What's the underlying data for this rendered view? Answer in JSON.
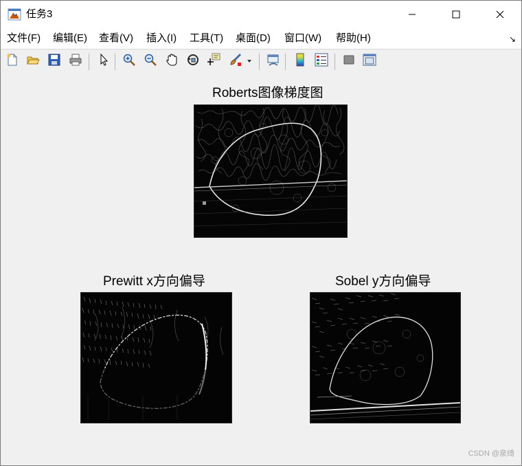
{
  "window": {
    "title": "任务3",
    "icon": "matlab-figure-icon",
    "controls": [
      "minimize-icon",
      "maximize-icon",
      "close-icon"
    ]
  },
  "menubar": {
    "items": [
      {
        "label": "文件(F)"
      },
      {
        "label": "编辑(E)"
      },
      {
        "label": "查看(V)"
      },
      {
        "label": "插入(I)"
      },
      {
        "label": "工具(T)"
      },
      {
        "label": "桌面(D)"
      },
      {
        "label": "窗口(W)"
      },
      {
        "label": "帮助(H)"
      }
    ],
    "dock_arrow": "↘"
  },
  "toolbar": {
    "tools": [
      "new-figure-icon",
      "open-icon",
      "save-icon",
      "print-icon",
      "select-arrow-icon",
      "zoom-in-icon",
      "zoom-out-icon",
      "pan-hand-icon",
      "rotate-3d-icon",
      "data-cursor-icon",
      "brush-icon",
      "brush-dropdown-icon",
      "link-plot-icon",
      "colorbar-icon",
      "legend-icon",
      "hide-plot-tools-icon",
      "show-plot-tools-icon"
    ]
  },
  "axes": [
    {
      "title": "Roberts图像梯度图"
    },
    {
      "title": "Prewitt x方向偏导"
    },
    {
      "title": "Sobel y方向偏导"
    }
  ],
  "watermark": "CSDN @泉绮",
  "colors": {
    "figure_bg": "#f0f0f0",
    "titlebar_bg": "#ffffff",
    "image_bg": "#000000"
  }
}
